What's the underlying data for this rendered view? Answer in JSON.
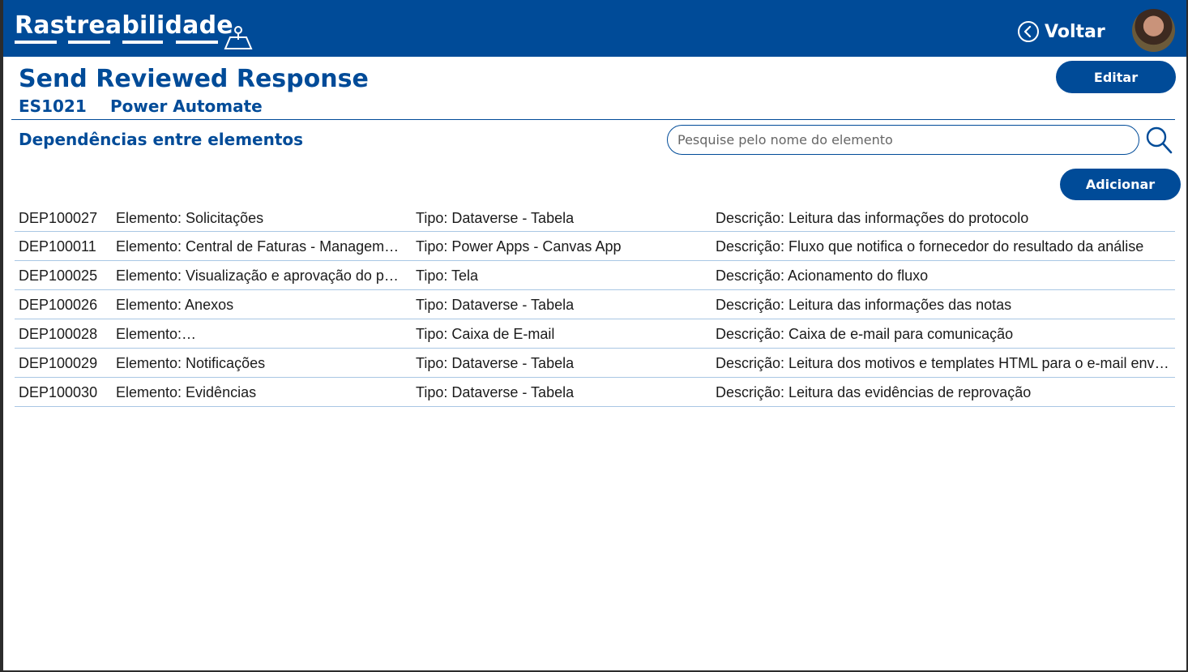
{
  "header": {
    "brand": "Rastreabilidade",
    "back_label": "Voltar"
  },
  "page": {
    "title": "Send Reviewed Response",
    "code": "ES1021",
    "type": "Power Automate",
    "edit_label": "Editar"
  },
  "section": {
    "title": "Dependências entre elementos",
    "search_placeholder": "Pesquise pelo nome do elemento",
    "add_label": "Adicionar"
  },
  "rows": [
    {
      "id": "DEP100027",
      "elemento": "Elemento: Solicitações",
      "tipo": "Tipo: Dataverse - Tabela",
      "descricao": "Descrição: Leitura das informações do protocolo"
    },
    {
      "id": "DEP100011",
      "elemento": "Elemento: Central de Faturas - Management Hub",
      "tipo": "Tipo: Power Apps - Canvas App",
      "descricao": "Descrição: Fluxo que notifica o fornecedor do resultado da análise"
    },
    {
      "id": "DEP100025",
      "elemento": "Elemento: Visualização e aprovação do protocolo",
      "tipo": "Tipo: Tela",
      "descricao": "Descrição: Acionamento do fluxo"
    },
    {
      "id": "DEP100026",
      "elemento": "Elemento: Anexos",
      "tipo": "Tipo: Dataverse - Tabela",
      "descricao": "Descrição: Leitura das informações das notas"
    },
    {
      "id": "DEP100028",
      "elemento": "Elemento:",
      "tipo": "Tipo: Caixa de E-mail",
      "descricao": "Descrição: Caixa de e-mail para comunicação"
    },
    {
      "id": "DEP100029",
      "elemento": "Elemento: Notificações",
      "tipo": "Tipo: Dataverse - Tabela",
      "descricao": "Descrição: Leitura dos motivos e templates HTML para o e-mail enviado"
    },
    {
      "id": "DEP100030",
      "elemento": "Elemento: Evidências",
      "tipo": "Tipo: Dataverse - Tabela",
      "descricao": "Descrição: Leitura das evidências de reprovação"
    }
  ],
  "icons": {
    "brand": "map-pin-icon",
    "back": "chevron-left-circle-icon",
    "search": "search-icon"
  },
  "colors": {
    "primary": "#004b98",
    "row_border": "#a9c7e4",
    "text": "#1b1b1b"
  }
}
